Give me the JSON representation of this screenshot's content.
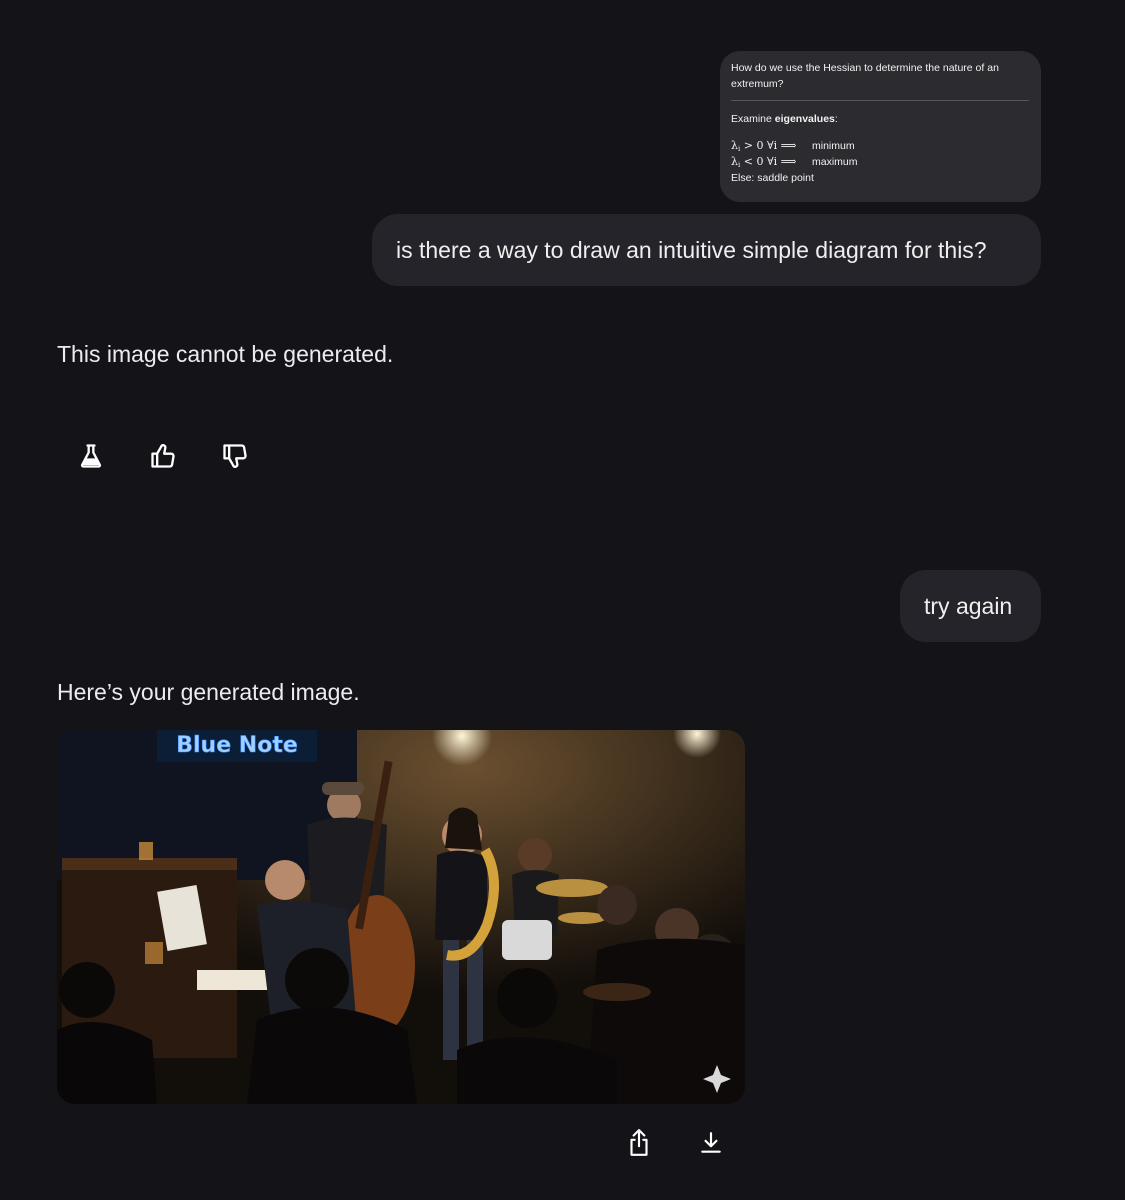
{
  "snippet": {
    "question": "How do we use the Hessian to determine the nature of an extremum?",
    "examine_prefix": "Examine ",
    "examine_bold": "eigenvalues",
    "examine_suffix": ":",
    "rule1_cond": "> 0 ∀i ⟹",
    "rule1_result": "minimum",
    "rule2_cond": "< 0 ∀i ⟹",
    "rule2_result": "maximum",
    "rule3": "Else: saddle point"
  },
  "messages": {
    "user1": "is there a way to draw an intuitive simple diagram for this?",
    "assistant1": "This image cannot be generated.",
    "user2": "try again",
    "assistant2": "Here’s your generated image."
  },
  "feedback_icons": [
    "flask-icon",
    "thumbs-up-icon",
    "thumbs-down-icon"
  ],
  "image_actions": [
    "share-icon",
    "download-icon"
  ],
  "generated_image": {
    "sign_text": "Blue Note"
  },
  "colors": {
    "background": "#131318",
    "bubble": "#24242a",
    "snippet": "#2b2b30",
    "neon_sign": "#7ab8ff"
  }
}
